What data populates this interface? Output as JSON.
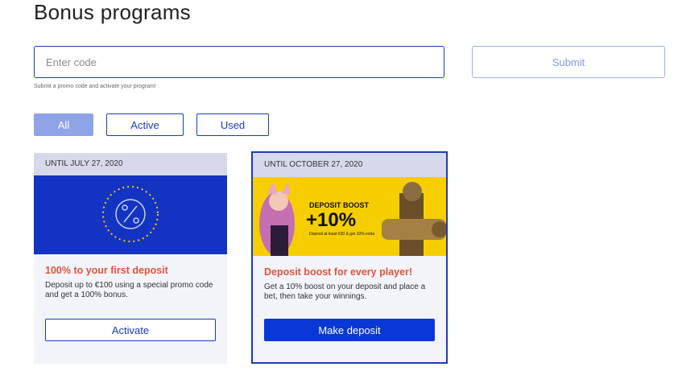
{
  "page": {
    "title": "Bonus programs"
  },
  "promo": {
    "placeholder": "Enter code",
    "submit_label": "Submit",
    "hint": "Submit a promo code and activate your program!"
  },
  "filters": [
    {
      "label": "All",
      "selected": true
    },
    {
      "label": "Active",
      "selected": false
    },
    {
      "label": "Used",
      "selected": false
    }
  ],
  "cards": [
    {
      "date": "UNTIL JULY 27, 2020",
      "title": "100% to your first deposit",
      "description": "Deposit up to €100 using a special promo code and get a 100% bonus.",
      "button": "Activate",
      "icon": "percent-badge-icon"
    },
    {
      "date": "UNTIL OCTOBER 27, 2020",
      "title": "Deposit boost for every player!",
      "description": "Get a 10% boost on your deposit and place a bet, then take your winnings.",
      "button": "Make deposit",
      "banner": {
        "heading": "DEPOSIT BOOST",
        "value": "+10%",
        "sub": "Deposit at least €30 & get 10% extra"
      }
    }
  ],
  "colors": {
    "accent": "#1c3bb8",
    "primary_button": "#0a38d6",
    "title_red": "#e0533f",
    "card_bg": "#f3f4f9",
    "date_bar": "#d5d9ea",
    "banner_blue": "#1333c2",
    "banner_yellow": "#f6ce00"
  }
}
